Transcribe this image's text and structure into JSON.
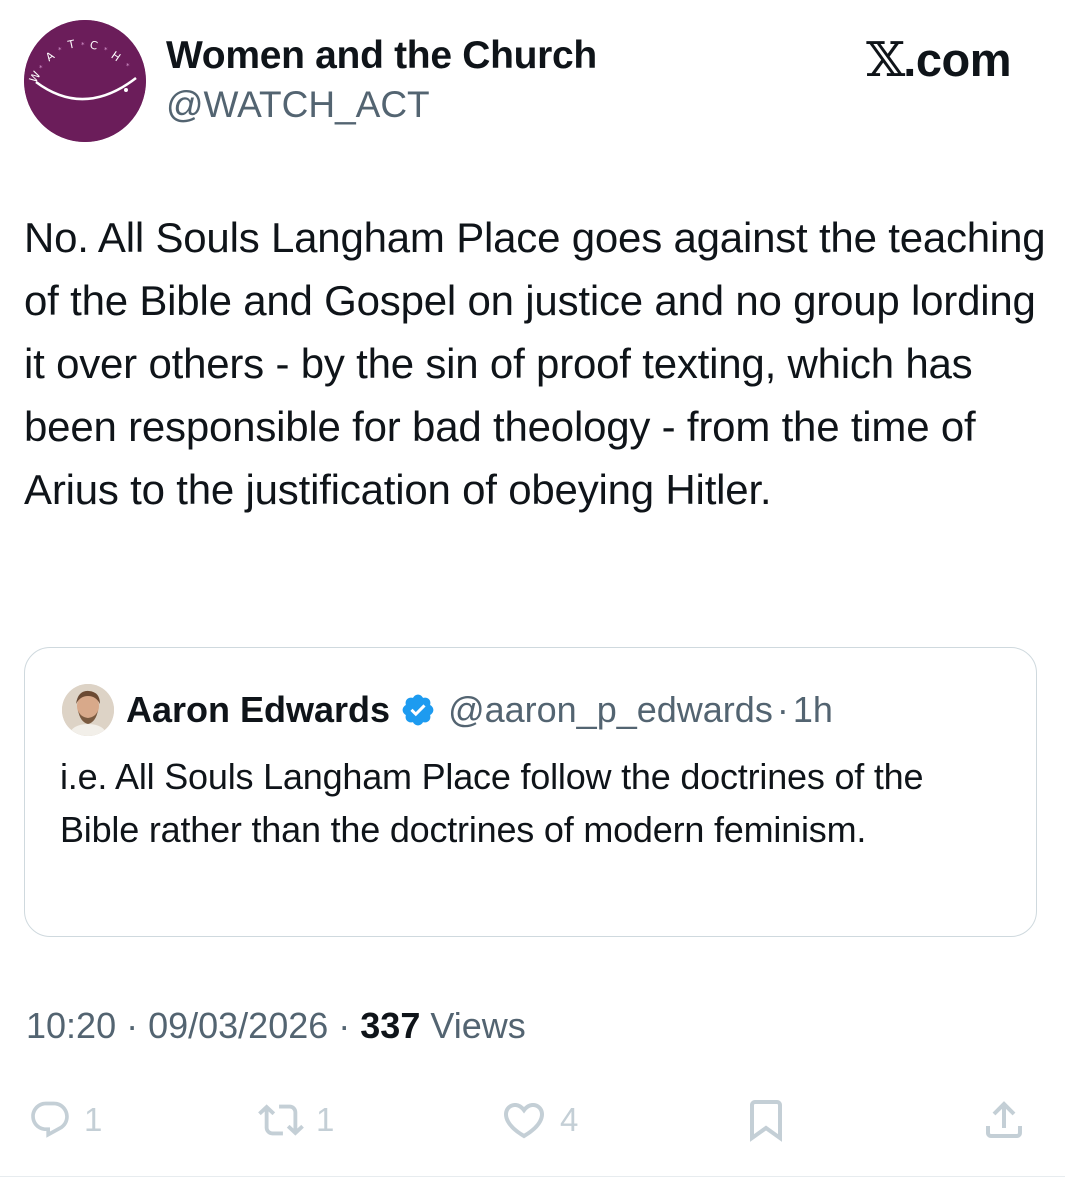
{
  "author": {
    "name": "Women and the Church",
    "handle": "@WATCH_ACT",
    "avatar_letters": "W A T C H"
  },
  "brand": {
    "x": "𝕏",
    "suffix": ".com"
  },
  "tweet": {
    "text": "No. All Souls Langham Place goes against the teaching of the Bible and Gospel on justice and no group lording it over others - by the sin of proof texting, which has been responsible for bad theology - from the time of Arius to the justification of obeying Hitler."
  },
  "quoted": {
    "name": "Aaron Edwards",
    "handle": "@aaron_p_edwards",
    "separator": "·",
    "time": "1h",
    "text": "i.e. All Souls Langham Place follow the doctrines of the Bible rather than the doctrines of modern feminism."
  },
  "meta": {
    "time": "10:20",
    "sep1": " · ",
    "date": "09/03/2026",
    "sep2": " · ",
    "views_count": "337",
    "views_label": " Views"
  },
  "actions": {
    "replies": "1",
    "reposts": "1",
    "likes": "4",
    "reply_icon": "reply-icon",
    "repost_icon": "repost-icon",
    "like_icon": "heart-icon",
    "bookmark_icon": "bookmark-icon",
    "share_icon": "share-icon"
  },
  "colors": {
    "avatar_bg": "#6b1d5a",
    "secondary_text": "#536471",
    "verified_blue": "#1d9bf0",
    "action_icons": "#c4cfd6"
  }
}
